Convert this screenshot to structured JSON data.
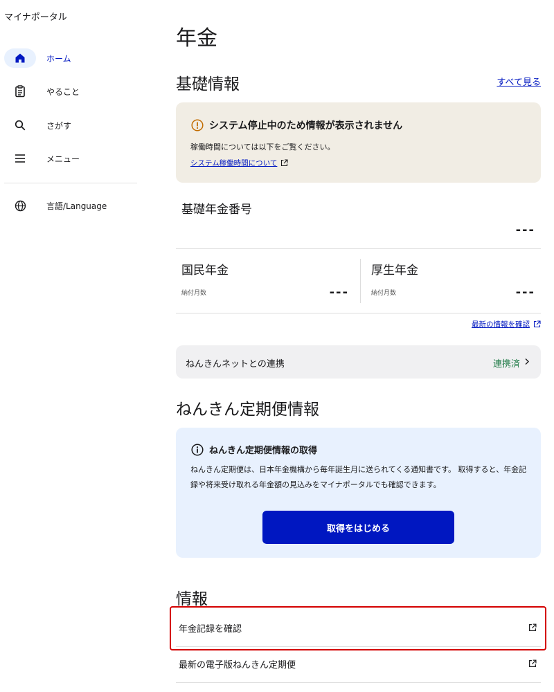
{
  "app": {
    "title": "マイナポータル"
  },
  "sidebar": {
    "items": [
      {
        "label": "ホーム",
        "icon": "home-icon",
        "active": true
      },
      {
        "label": "やること",
        "icon": "clipboard-icon"
      },
      {
        "label": "さがす",
        "icon": "search-icon"
      },
      {
        "label": "メニュー",
        "icon": "menu-icon"
      }
    ],
    "language_label": "言語/Language"
  },
  "main": {
    "page_title": "年金",
    "basic_info": {
      "heading": "基礎情報",
      "see_all": "すべて見る",
      "notice": {
        "title": "システム停止中のため情報が表示されません",
        "text": "稼働時間については以下をご覧ください。",
        "link": "システム稼働時間について"
      },
      "basic_pension_number_label": "基礎年金番号",
      "basic_pension_number_value": "---",
      "national_pension": {
        "title": "国民年金",
        "sub_label": "納付月数",
        "value": "---"
      },
      "employee_pension": {
        "title": "厚生年金",
        "sub_label": "納付月数",
        "value": "---"
      },
      "latest_link": "最新の情報を確認",
      "nenkin_net": {
        "label": "ねんきんネットとの連携",
        "status": "連携済"
      }
    },
    "teikibin": {
      "heading": "ねんきん定期便情報",
      "box_title": "ねんきん定期便情報の取得",
      "box_text": "ねんきん定期便は、日本年金機構から毎年誕生月に送られてくる通知書です。 取得すると、年金記録や将来受け取れる年金額の見込みをマイナポータルでも確認できます。",
      "button_label": "取得をはじめる"
    },
    "info": {
      "heading": "情報",
      "rows": [
        {
          "label": "年金記録を確認"
        },
        {
          "label": "最新の電子版ねんきん定期便"
        }
      ]
    }
  },
  "colors": {
    "accent": "#0017c1",
    "active_bg": "#e8f1fe",
    "notice_bg": "#f1ede4",
    "warning": "#c26c00",
    "linked_status": "#1e7a46",
    "highlight": "#d40000"
  }
}
